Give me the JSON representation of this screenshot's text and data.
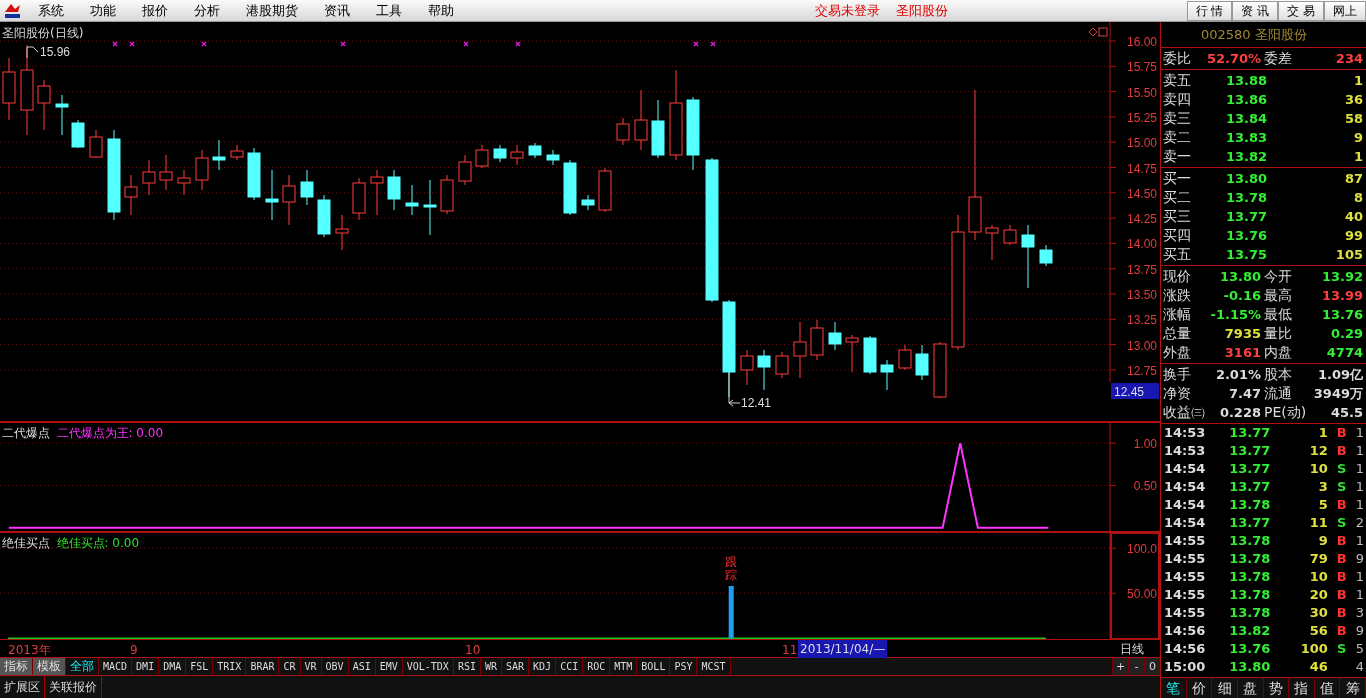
{
  "menu_bar": {
    "items": [
      "系统",
      "功能",
      "报价",
      "分析",
      "港股期货",
      "资讯",
      "工具",
      "帮助"
    ],
    "status": "交易未登录",
    "stock_name": "圣阳股份",
    "buttons": [
      "行 情",
      "资 讯",
      "交 易",
      "网上"
    ]
  },
  "price_chart": {
    "title": "圣阳股份(日线)",
    "high_label": "15.96",
    "low_label": "12.41",
    "yticks": [
      "16.00",
      "15.75",
      "15.50",
      "15.25",
      "15.00",
      "14.75",
      "14.50",
      "14.25",
      "14.00",
      "13.75",
      "13.50",
      "13.25",
      "13.00",
      "12.75"
    ],
    "cursor_price": "12.45"
  },
  "indicator_1": {
    "name": "二代爆点",
    "value_label": ": 0.00",
    "chart_data": {
      "type": "line",
      "ylim": [
        -0.05,
        1.25
      ],
      "yticks": [
        {
          "value": 0.5,
          "label": "0.50"
        },
        {
          "value": 1,
          "label": "1.00"
        }
      ],
      "series": [
        {
          "name": "二代爆点为王",
          "color": "#ff33ff",
          "values": [
            0,
            0,
            0,
            0,
            0,
            0,
            0,
            0,
            0,
            0,
            0,
            0,
            0,
            0,
            0,
            0,
            0,
            0,
            0,
            0,
            0,
            0,
            0,
            0,
            0,
            0,
            0,
            0,
            0,
            0,
            0,
            0,
            0,
            0,
            0,
            0,
            0,
            0,
            0,
            0,
            0,
            0,
            0,
            0,
            0,
            0,
            0,
            0,
            0,
            0,
            0,
            0,
            0,
            0,
            1,
            0,
            0,
            0,
            0,
            0,
            null,
            null,
            null
          ]
        }
      ]
    }
  },
  "indicator_2": {
    "name": "绝佳买点",
    "value_label": ": 0.00",
    "signal_text": "跟踪",
    "chart_data": {
      "type": "bar",
      "ylim": [
        -2,
        118
      ],
      "yticks": [
        {
          "value": 50,
          "label": "50.00"
        },
        {
          "value": 100,
          "label": "100.0"
        }
      ],
      "series": [
        {
          "name": "绝佳买点",
          "color": "#1ea0f0",
          "values": [
            0,
            0,
            0,
            0,
            0,
            0,
            0,
            0,
            0,
            0,
            0,
            0,
            0,
            0,
            0,
            0,
            0,
            0,
            0,
            0,
            0,
            0,
            0,
            0,
            0,
            0,
            0,
            0,
            0,
            0,
            0,
            0,
            0,
            0,
            0,
            0,
            0,
            0,
            0,
            0,
            0,
            58,
            0,
            0,
            0,
            0,
            0,
            0,
            0,
            0,
            0,
            0,
            0,
            0,
            0,
            0,
            0,
            0,
            0,
            0,
            null,
            null,
            null
          ]
        }
      ]
    }
  },
  "date_axis": {
    "labels": [
      "2013年",
      "9",
      "10",
      "11"
    ],
    "cursor_date": "2013/11/04/—",
    "period": "日线"
  },
  "indicator_tabs": [
    {
      "label": "指标",
      "selected": false
    },
    {
      "label": "模板",
      "selected": false
    },
    {
      "label": "全部",
      "selected": true
    },
    {
      "label": "MACD",
      "selected": false
    },
    {
      "label": "DMI",
      "selected": false
    },
    {
      "label": "DMA",
      "selected": false
    },
    {
      "label": "FSL",
      "selected": false
    },
    {
      "label": "TRIX",
      "selected": false
    },
    {
      "label": "BRAR",
      "selected": false
    },
    {
      "label": "CR",
      "selected": false
    },
    {
      "label": "VR",
      "selected": false
    },
    {
      "label": "OBV",
      "selected": false
    },
    {
      "label": "ASI",
      "selected": false
    },
    {
      "label": "EMV",
      "selected": false
    },
    {
      "label": "VOL-TDX",
      "selected": false
    },
    {
      "label": "RSI",
      "selected": false
    },
    {
      "label": "WR",
      "selected": false
    },
    {
      "label": "SAR",
      "selected": false
    },
    {
      "label": "KDJ",
      "selected": false
    },
    {
      "label": "CCI",
      "selected": false
    },
    {
      "label": "ROC",
      "selected": false
    },
    {
      "label": "MTM",
      "selected": false
    },
    {
      "label": "BOLL",
      "selected": false
    },
    {
      "label": "PSY",
      "selected": false
    },
    {
      "label": "MCST",
      "selected": false
    }
  ],
  "zoom_buttons": [
    "+",
    "-",
    "0"
  ],
  "bottom_tabs": [
    "扩展区",
    "关联报价"
  ],
  "quote_panel": {
    "header": "002580 圣阳股份",
    "commission": [
      {
        "label": "委比",
        "value": "52.70%",
        "color": "#ff4040"
      },
      {
        "label": "委差",
        "value": "234",
        "color": "#ff4040"
      }
    ],
    "asks": [
      {
        "label": "卖五",
        "price": "13.88",
        "volume": "1"
      },
      {
        "label": "卖四",
        "price": "13.86",
        "volume": "36"
      },
      {
        "label": "卖三",
        "price": "13.84",
        "volume": "58"
      },
      {
        "label": "卖二",
        "price": "13.83",
        "volume": "9"
      },
      {
        "label": "卖一",
        "price": "13.82",
        "volume": "1"
      }
    ],
    "bids": [
      {
        "label": "买一",
        "price": "13.80",
        "volume": "87"
      },
      {
        "label": "买二",
        "price": "13.78",
        "volume": "8"
      },
      {
        "label": "买三",
        "price": "13.77",
        "volume": "40"
      },
      {
        "label": "买四",
        "price": "13.76",
        "volume": "99"
      },
      {
        "label": "买五",
        "price": "13.75",
        "volume": "105"
      }
    ],
    "stats": [
      [
        {
          "label": "现价",
          "value": "13.80",
          "color": "#33ee33"
        },
        {
          "label": "今开",
          "value": "13.92",
          "color": "#33ee33"
        }
      ],
      [
        {
          "label": "涨跌",
          "value": "-0.16",
          "color": "#33ee33"
        },
        {
          "label": "最高",
          "value": "13.99",
          "color": "#ff4040"
        }
      ],
      [
        {
          "label": "涨幅",
          "value": "-1.15%",
          "color": "#33ee33"
        },
        {
          "label": "最低",
          "value": "13.76",
          "color": "#33ee33"
        }
      ],
      [
        {
          "label": "总量",
          "value": "7935",
          "color": "#e0e040"
        },
        {
          "label": "量比",
          "value": "0.29",
          "color": "#33ee33"
        }
      ],
      [
        {
          "label": "外盘",
          "value": "3161",
          "color": "#ff4040"
        },
        {
          "label": "内盘",
          "value": "4774",
          "color": "#33ee33"
        }
      ]
    ],
    "fundamentals": [
      [
        {
          "label": "换手",
          "value": "2.01%"
        },
        {
          "label": "股本",
          "value": "1.09亿"
        }
      ],
      [
        {
          "label": "净资",
          "value": "7.47"
        },
        {
          "label": "流通",
          "value": "3949万"
        }
      ],
      [
        {
          "label": "收益㈢",
          "value": "0.228"
        },
        {
          "label": "PE(动)",
          "value": "45.5"
        }
      ]
    ],
    "trades": [
      {
        "time": "14:53",
        "price": "13.77",
        "volume": "1",
        "side": "B",
        "color": "#ff3232",
        "count": "1"
      },
      {
        "time": "14:53",
        "price": "13.77",
        "volume": "12",
        "side": "B",
        "color": "#ff3232",
        "count": "1"
      },
      {
        "time": "14:54",
        "price": "13.77",
        "volume": "10",
        "side": "S",
        "color": "#33dd33",
        "count": "1"
      },
      {
        "time": "14:54",
        "price": "13.77",
        "volume": "3",
        "side": "S",
        "color": "#33dd33",
        "count": "1"
      },
      {
        "time": "14:54",
        "price": "13.78",
        "volume": "5",
        "side": "B",
        "color": "#ff3232",
        "count": "1"
      },
      {
        "time": "14:54",
        "price": "13.77",
        "volume": "11",
        "side": "S",
        "color": "#33dd33",
        "count": "2"
      },
      {
        "time": "14:55",
        "price": "13.78",
        "volume": "9",
        "side": "B",
        "color": "#ff3232",
        "count": "1"
      },
      {
        "time": "14:55",
        "price": "13.78",
        "volume": "79",
        "side": "B",
        "color": "#ff3232",
        "count": "9"
      },
      {
        "time": "14:55",
        "price": "13.78",
        "volume": "10",
        "side": "B",
        "color": "#ff3232",
        "count": "1"
      },
      {
        "time": "14:55",
        "price": "13.78",
        "volume": "20",
        "side": "B",
        "color": "#ff3232",
        "count": "1"
      },
      {
        "time": "14:55",
        "price": "13.78",
        "volume": "30",
        "side": "B",
        "color": "#ff3232",
        "count": "3"
      },
      {
        "time": "14:56",
        "price": "13.82",
        "volume": "56",
        "side": "B",
        "color": "#ff3232",
        "count": "9"
      },
      {
        "time": "14:56",
        "price": "13.76",
        "volume": "100",
        "side": "S",
        "color": "#33dd33",
        "count": "5"
      },
      {
        "time": "15:00",
        "price": "13.80",
        "volume": "46",
        "count": "4"
      }
    ],
    "tabs": [
      {
        "label": "笔",
        "selected": true
      },
      {
        "label": "价",
        "selected": false
      },
      {
        "label": "细",
        "selected": false
      },
      {
        "label": "盘",
        "selected": false
      },
      {
        "label": "势",
        "selected": false
      },
      {
        "label": "指",
        "selected": false
      },
      {
        "label": "值",
        "selected": false
      },
      {
        "label": "筹",
        "selected": false
      }
    ]
  }
}
